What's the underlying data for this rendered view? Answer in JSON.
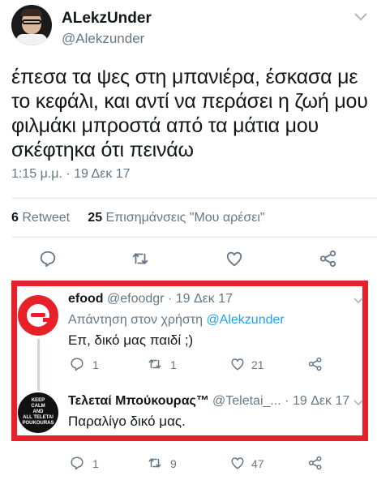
{
  "main_tweet": {
    "author_name": "ALekzUnder",
    "author_handle": "@Alekzunder",
    "text": "έπεσα τα ψες στη μπανιέρα, έσκασα με το κεφάλι, και αντί να περάσει η ζωή μου φιλμάκι μπροστά από τα μάτια μου σκέφτηκα ότι πεινάω",
    "timestamp": "1:15 μ.μ. · 19 Δεκ 17",
    "retweet_count": "6",
    "retweet_label": "Retweet",
    "likes_count": "25",
    "likes_label": "Επισημάνσεις \"Μου αρέσει\""
  },
  "replies": [
    {
      "name": "efood",
      "handle_date": "@efoodgr · 19 Δεκ 17",
      "reply_to_prefix": "Απάντηση στον χρήστη",
      "reply_to_mention": "@Alekzunder",
      "text": "Επ, δικό μας παιδί ;)",
      "reply_count": "1",
      "retweet_count": "1",
      "like_count": "21"
    },
    {
      "name": "Τελεταί Μπούκουρας™",
      "handle_date": "@Teletai_... · 19 Δεκ 17",
      "avatar_text": "KEEP\nCALM\nAND\nALL TELETAI\nPOUKOURAS",
      "text": "Παραλίγο δικό μας.",
      "reply_count": "1",
      "retweet_count": "9",
      "like_count": "47"
    }
  ],
  "icons": [
    "reply-icon",
    "retweet-icon",
    "like-icon",
    "share-icon",
    "chevron-down-icon"
  ],
  "colors": {
    "text": "#14171a",
    "secondary": "#657786",
    "link": "#1da1f2",
    "highlight_border": "#e8202a",
    "efood_brand": "#e8202a"
  }
}
